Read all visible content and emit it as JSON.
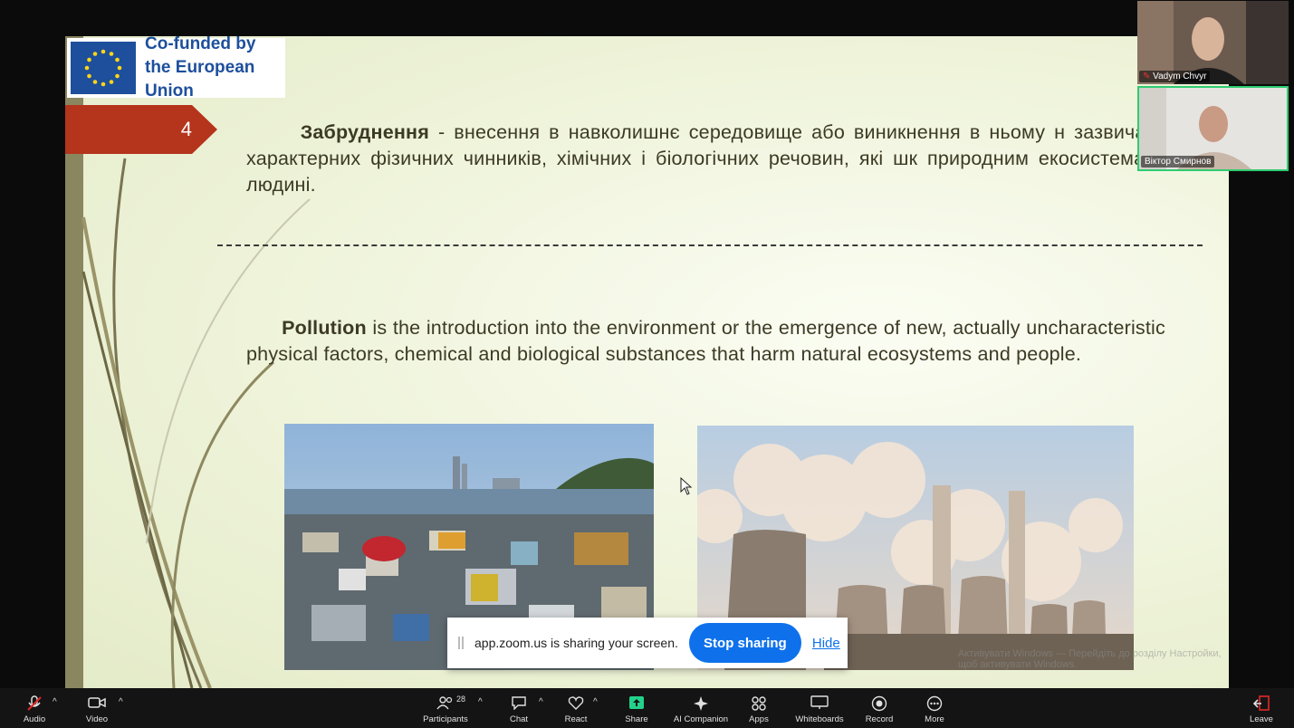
{
  "slide": {
    "logo_line1": "Co-funded by",
    "logo_line2": "the European Union",
    "slide_number": "4",
    "ua_term": "Забруднення",
    "ua_text": " - внесення в навколишнє середовище або виникнення в ньому н зазвичай не характерних фізичних чинників, хімічних і біологічних речовин, які шк природним екосистемам та людині.",
    "en_term": "Pollution",
    "en_text": " is the introduction into the environment or the emergence of new, actually uncharacteristic physical factors, chemical and biological substances that harm natural ecosystems and people.",
    "windows_activation": "Активувати Windows — Перейдіть до розділу Настройки, щоб активувати Windows."
  },
  "share_bar": {
    "message": "app.zoom.us is sharing your screen.",
    "stop_label": "Stop sharing",
    "hide_label": "Hide"
  },
  "participants": [
    {
      "name": "Vadym Chvyr"
    },
    {
      "name": "Віктор Смирнов"
    }
  ],
  "toolbar": {
    "audio": "Audio",
    "video": "Video",
    "participants": "Participants",
    "participants_count": "28",
    "chat": "Chat",
    "react": "React",
    "share": "Share",
    "ai_companion": "AI Companion",
    "apps": "Apps",
    "whiteboards": "Whiteboards",
    "record": "Record",
    "more": "More",
    "leave": "Leave"
  },
  "colors": {
    "share_green": "#23d18b",
    "leave_red": "#e02828",
    "stop_blue": "#0e71eb",
    "tab_red": "#b5341c"
  }
}
